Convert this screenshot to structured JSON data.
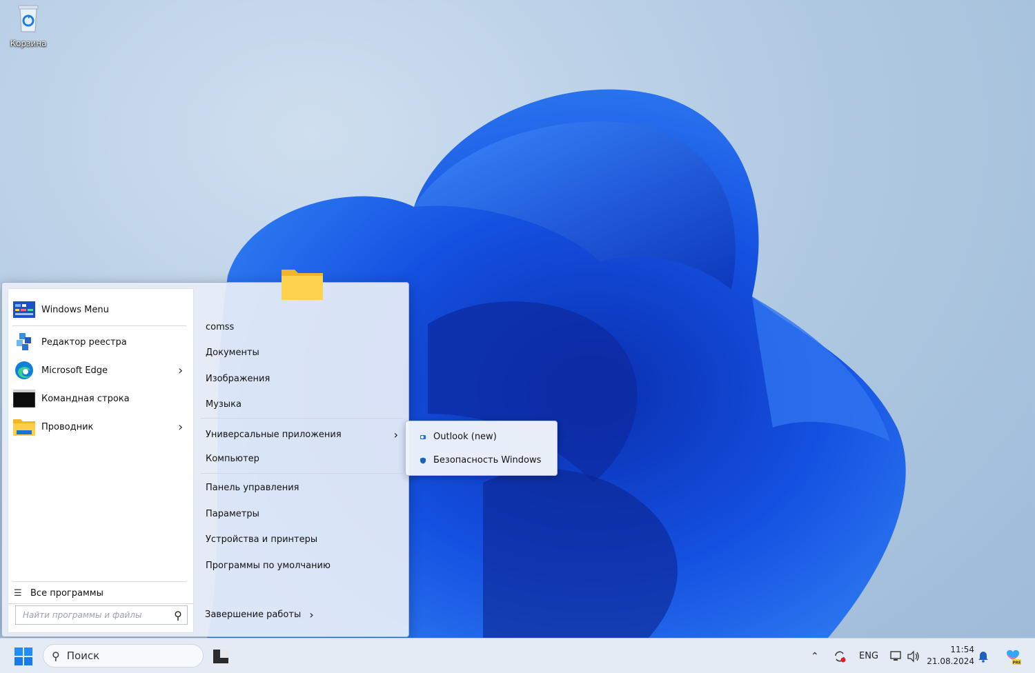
{
  "desktop": {
    "recycle_bin_label": "Корзина"
  },
  "start_menu": {
    "pinned": [
      {
        "label": "Windows Menu",
        "icon": "windows-menu-icon",
        "has_submenu": false
      },
      {
        "label": "Редактор реестра",
        "icon": "registry-editor-icon",
        "has_submenu": false
      },
      {
        "label": "Microsoft Edge",
        "icon": "edge-icon",
        "has_submenu": true
      },
      {
        "label": "Командная строка",
        "icon": "command-prompt-icon",
        "has_submenu": false
      },
      {
        "label": "Проводник",
        "icon": "file-explorer-icon",
        "has_submenu": true
      }
    ],
    "all_programs_label": "Все программы",
    "search_placeholder": "Найти программы и файлы",
    "places": [
      {
        "label": "comss"
      },
      {
        "label": "Документы"
      },
      {
        "label": "Изображения"
      },
      {
        "label": "Музыка"
      },
      {
        "label": "Универсальные приложения",
        "has_submenu": true
      },
      {
        "label": "Компьютер"
      },
      {
        "label": "Панель управления"
      },
      {
        "label": "Параметры"
      },
      {
        "label": "Устройства и принтеры"
      },
      {
        "label": "Программы по умолчанию"
      }
    ],
    "shutdown_label": "Завершение работы"
  },
  "submenu": {
    "items": [
      {
        "label": "Outlook (new)",
        "icon": "outlook-icon"
      },
      {
        "label": "Безопасность Windows",
        "icon": "windows-security-icon"
      }
    ]
  },
  "taskbar": {
    "search_label": "Поиск",
    "language": "ENG",
    "time": "11:54",
    "date": "21.08.2024",
    "copilot_badge": "PRE"
  },
  "colors": {
    "accent": "#0a5fd6",
    "taskbar_bg": "#e4ebf4"
  }
}
